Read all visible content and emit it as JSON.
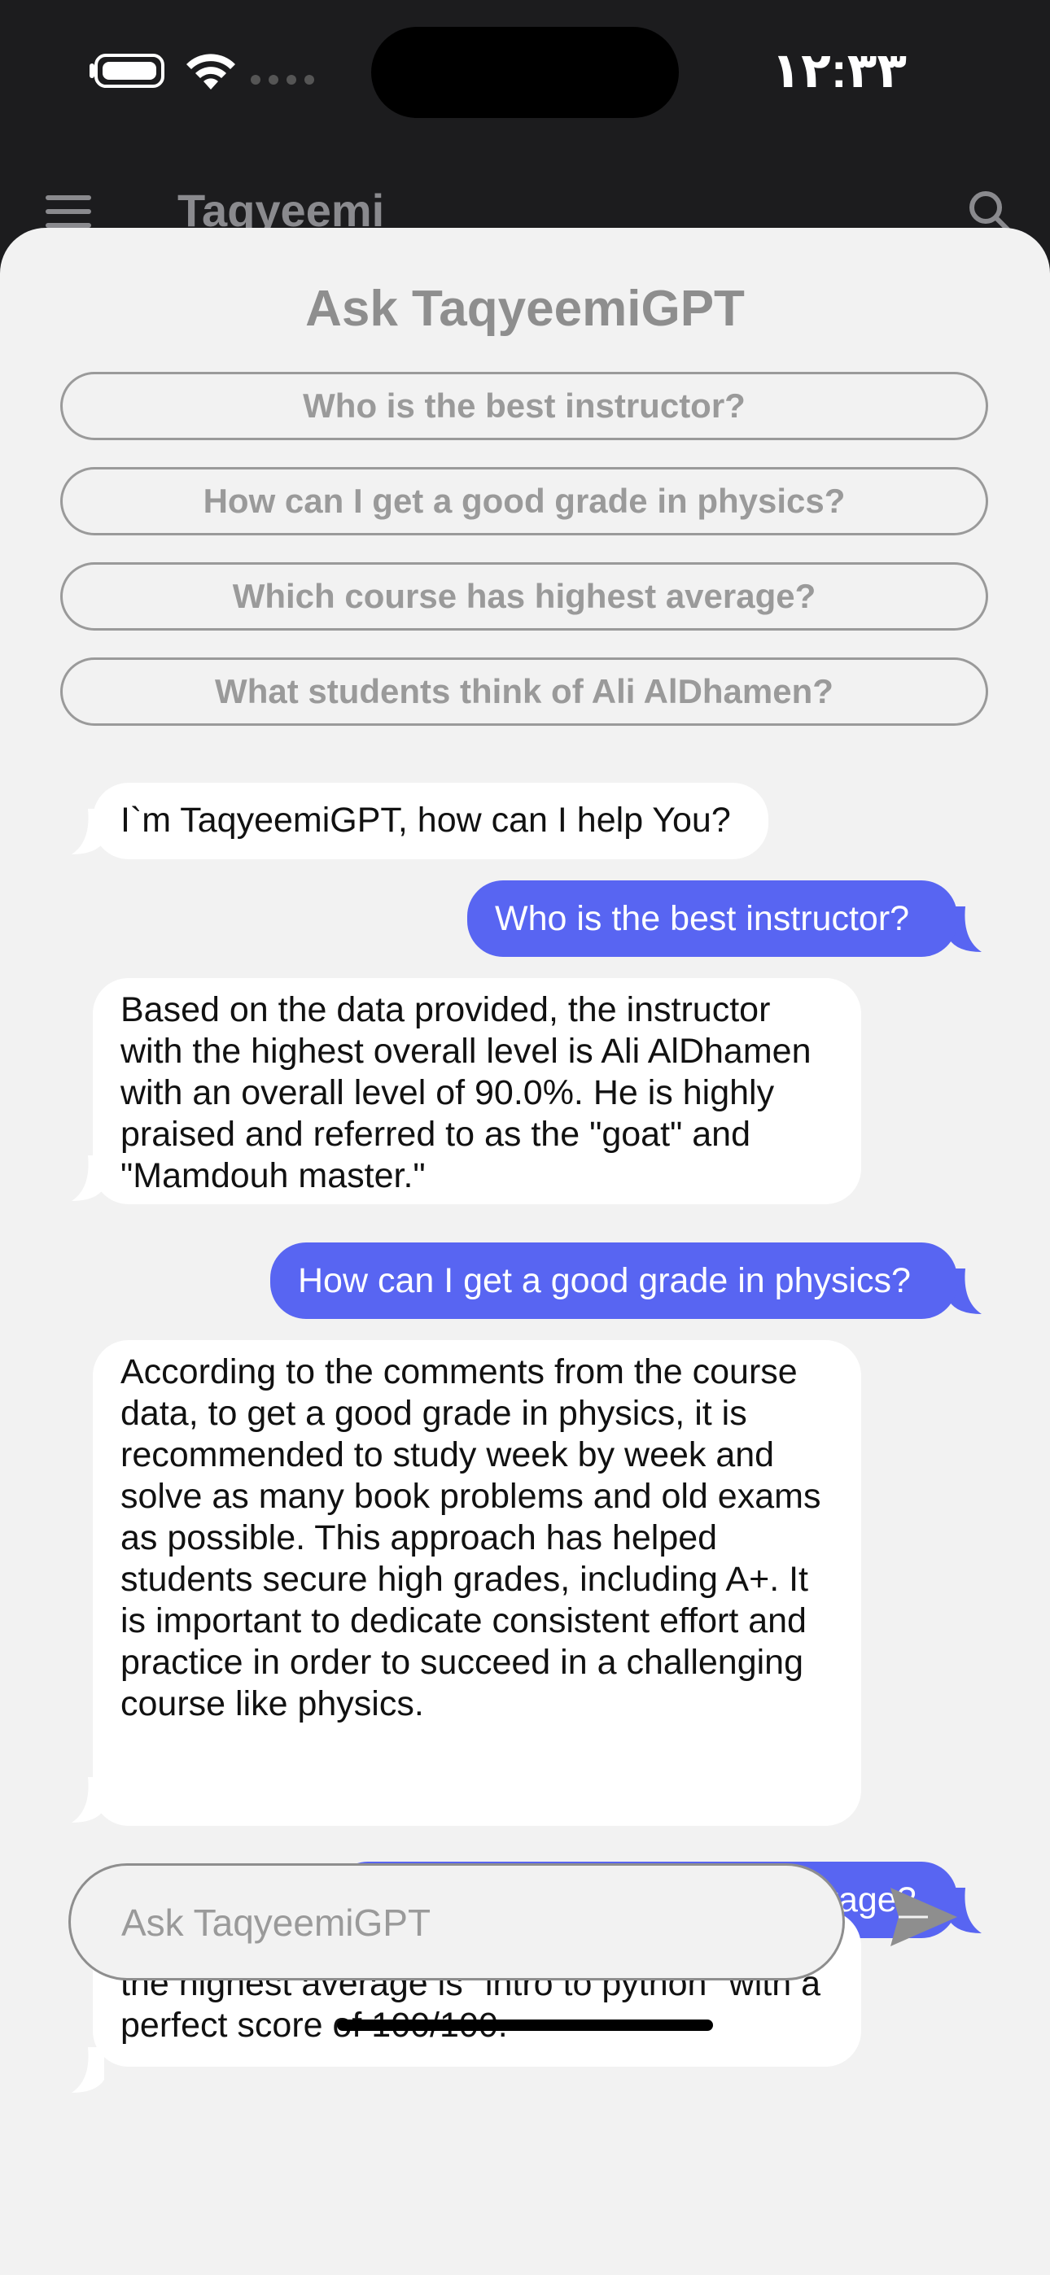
{
  "status_bar": {
    "time": "١٢:٣٣"
  },
  "app_bar": {
    "title": "Taqyeemi"
  },
  "sheet": {
    "title": "Ask TaqyeemiGPT",
    "suggestions": [
      "Who is the best instructor?",
      "How can I get a good grade in physics?",
      "Which course has highest average?",
      "What students think of Ali AlDhamen?"
    ]
  },
  "messages": [
    {
      "role": "bot",
      "text": "I`m TaqyeemiGPT, how can I help You?"
    },
    {
      "role": "user",
      "text": "Who is the best instructor?"
    },
    {
      "role": "bot",
      "text": "Based on the data provided, the instructor with the highest overall level is Ali AlDhamen with an overall level of 90.0%. He is highly praised and referred to as the \"goat\" and \"Mamdouh master.\""
    },
    {
      "role": "user",
      "text": "How can I get a good grade in physics?"
    },
    {
      "role": "bot",
      "text": "According to the comments from the course data, to get a good grade in physics, it is recommended to study week by week and solve as many book problems and old exams as possible. This approach has helped students secure high grades, including A+. It is important to dedicate consistent effort and practice in order to succeed in a challenging course like physics."
    },
    {
      "role": "user",
      "text": "Which course has highest average?"
    },
    {
      "role": "bot",
      "text": "Among the provided courses, the course with the highest average is \"intro to python\" with a perfect score of 100/100."
    }
  ],
  "composer": {
    "placeholder": "Ask TaqyeemiGPT",
    "value": ""
  },
  "colors": {
    "user_bubble": "#5865f2",
    "bot_bubble": "#ffffff",
    "sheet_bg": "#f2f2f2",
    "status_bg": "#1c1c1e"
  }
}
